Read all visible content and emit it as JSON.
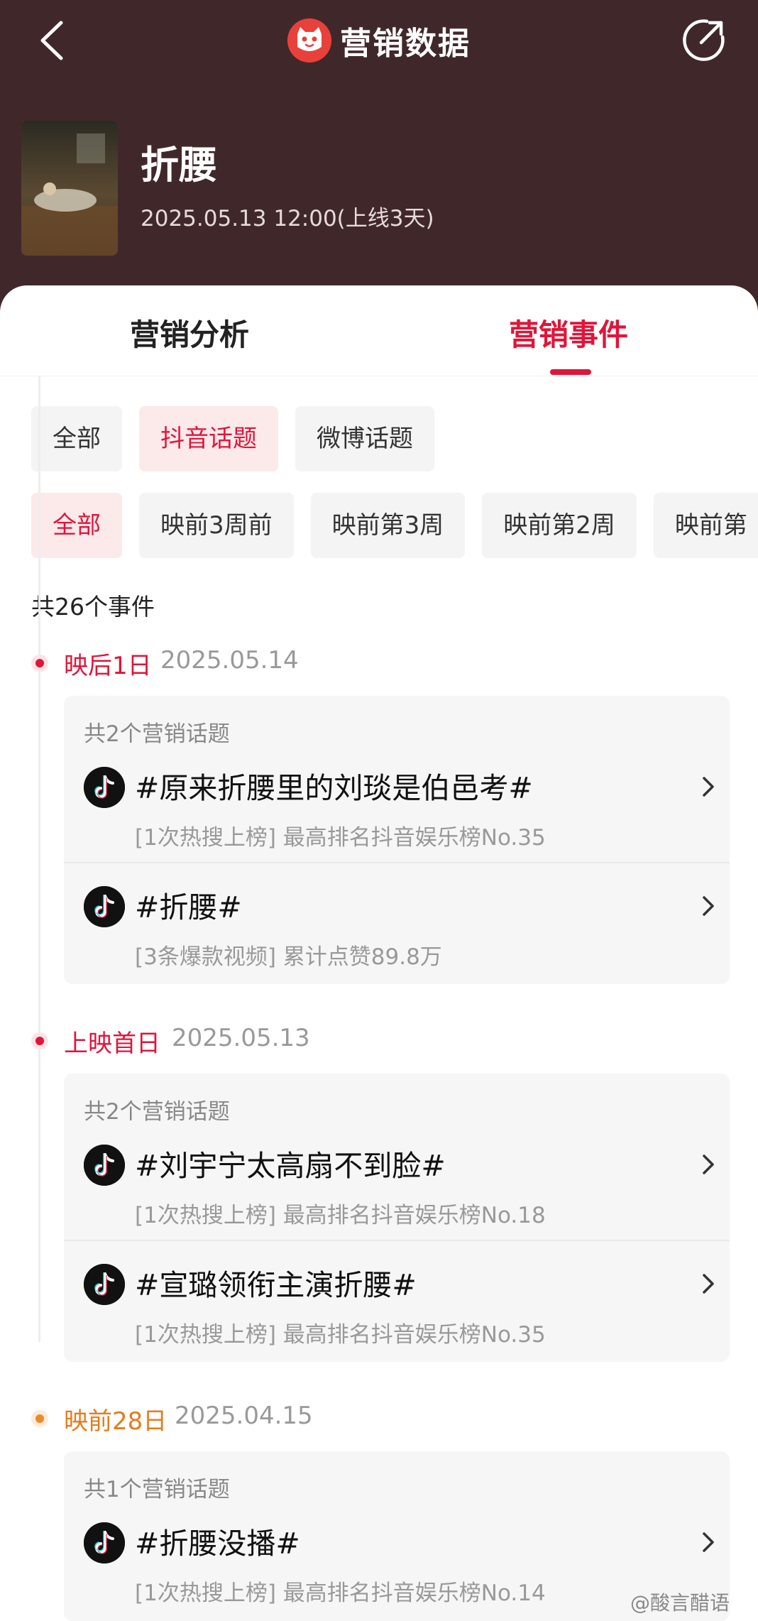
{
  "header": {
    "title": "营销数据",
    "back_icon": "chevron-left-icon",
    "share_icon": "share-icon",
    "logo_icon": "cat-logo-icon",
    "background": "#40282a"
  },
  "movie": {
    "title": "折腰",
    "date": "2025.05.13 12:00(上线3天)"
  },
  "tabs": [
    {
      "label": "营销分析",
      "active": false
    },
    {
      "label": "营销事件",
      "active": true
    }
  ],
  "platform_filters": [
    {
      "label": "全部",
      "active": false
    },
    {
      "label": "抖音话题",
      "active": true
    },
    {
      "label": "微博话题",
      "active": false
    }
  ],
  "period_filters": [
    {
      "label": "全部",
      "active": true
    },
    {
      "label": "映前3周前",
      "active": false
    },
    {
      "label": "映前第3周",
      "active": false
    },
    {
      "label": "映前第2周",
      "active": false
    },
    {
      "label": "映前第",
      "active": false
    }
  ],
  "event_count": "共26个事件",
  "groups": [
    {
      "label": "映后1日",
      "date": "2025.05.14",
      "color": "#e0153a",
      "summary": "共2个营销话题",
      "items": [
        {
          "title": "#原来折腰里的刘琰是伯邑考#",
          "sub": "[1次热搜上榜] 最高排名抖音娱乐榜No.35"
        },
        {
          "title": "#折腰#",
          "sub": "[3条爆款视频] 累计点赞89.8万"
        }
      ]
    },
    {
      "label": "上映首日",
      "date": "2025.05.13",
      "color": "#e0153a",
      "summary": "共2个营销话题",
      "items": [
        {
          "title": "#刘宇宁太高扇不到脸#",
          "sub": "[1次热搜上榜] 最高排名抖音娱乐榜No.18"
        },
        {
          "title": "#宣璐领衔主演折腰#",
          "sub": "[1次热搜上榜] 最高排名抖音娱乐榜No.35"
        }
      ]
    },
    {
      "label": "映前28日",
      "date": "2025.04.15",
      "color": "#e57c1c",
      "summary": "共1个营销话题",
      "items": [
        {
          "title": "#折腰没播#",
          "sub": "[1次热搜上榜] 最高排名抖音娱乐榜No.14"
        }
      ]
    }
  ],
  "watermark": "@酸言醋语",
  "colors": {
    "accent": "#e0153a",
    "accent_orange": "#e57c1c",
    "header_bg": "#40282a"
  }
}
